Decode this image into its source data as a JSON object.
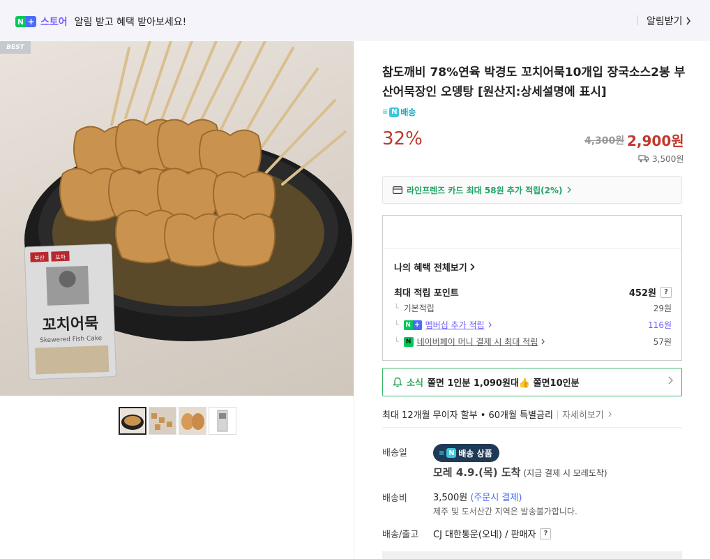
{
  "topbar": {
    "store_label": "스토어",
    "message": "알림 받고 혜택 받아보세요!",
    "alarm_label": "알림받기"
  },
  "gallery": {
    "best_label": "BEST",
    "package_labels": [
      "부산",
      "포차"
    ],
    "package_brand": "꼬치어묵",
    "package_sub": "Skewered Fish Cake"
  },
  "product": {
    "title": "참도깨비 78%연육 박경도 꼬치어묵10개입 장국소스2봉 부산어묵장인 오뎅탕 [원산지:상세설명에 표시]",
    "delivery_badge": "배송",
    "discount": "32%",
    "original_price": "4,300원",
    "sale_price": "2,900원",
    "shipping_fee": "3,500원"
  },
  "card_promo": {
    "text": "라인프렌즈 카드 최대 58원 추가 적립(2%)"
  },
  "benefits": {
    "view_all": "나의 혜택 전체보기",
    "max_points_label": "최대 적립 포인트",
    "max_points_value": "452원",
    "basic_label": "기본적립",
    "basic_value": "29원",
    "membership_label": "멤버십 추가 적립",
    "membership_value": "116원",
    "npay_label": "네이버페이 머니 결제 시 최대 적립",
    "npay_value": "57원",
    "help": "?"
  },
  "news": {
    "tag": "소식",
    "text": "쫄면 1인분 1,090원대👍 쫄면10인분"
  },
  "installment": {
    "text": "최대 12개월 무이자 할부 • 60개월 특별금리",
    "more": "자세히보기"
  },
  "delivery": {
    "date_label": "배송일",
    "pill": "배송 상품",
    "arrival": "모레 4.9.(목) 도착",
    "arrival_note": "(지금 결제 시 모레도착)",
    "fee_label": "배송비",
    "fee_value": "3,500원",
    "fee_pay": "(주문시 결제)",
    "fee_note": "제주 및 도서산간 지역은 발송불가합니다.",
    "courier_label": "배송/출고",
    "courier_value": "CJ 대한통운(오네) / 판매자"
  },
  "colors": {
    "accent_red": "#c0392b",
    "naver_green": "#03c75a",
    "store_purple": "#7b5cff"
  }
}
